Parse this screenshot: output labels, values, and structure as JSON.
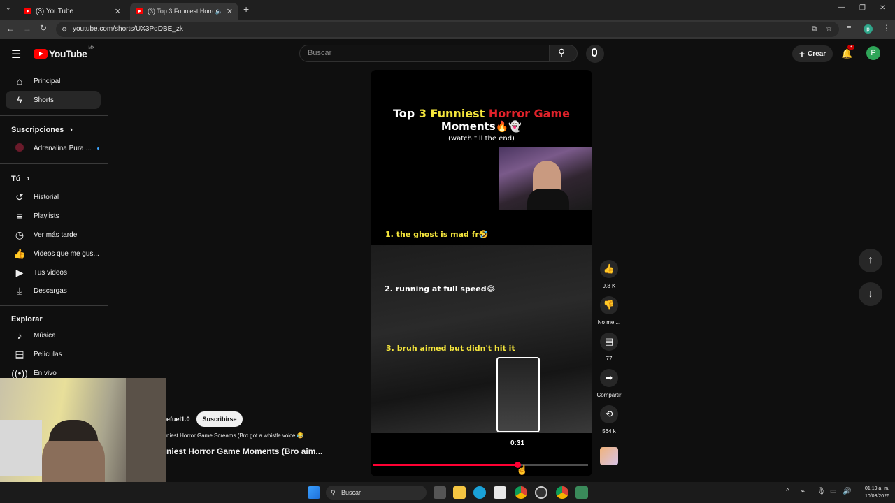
{
  "browser": {
    "tabs": [
      {
        "title": "(3) YouTube"
      },
      {
        "title": "(3) Top 3 Funniest Horror G"
      }
    ],
    "url": "youtube.com/shorts/UX3PqDBE_zk",
    "new_tab": "+"
  },
  "yt": {
    "logo_text": "YouTube",
    "logo_region": "MX",
    "search_placeholder": "Buscar",
    "create_label": "Crear",
    "notif_count": "3",
    "avatar_letter": "P"
  },
  "sidebar": {
    "main": [
      {
        "label": "Principal",
        "icon": "home-icon"
      },
      {
        "label": "Shorts",
        "icon": "shorts-icon"
      }
    ],
    "subs_title": "Suscripciones",
    "subs": [
      {
        "label": "Adrenalina Pura ..."
      }
    ],
    "you_title": "Tú",
    "you": [
      {
        "label": "Historial",
        "icon": "history-icon"
      },
      {
        "label": "Playlists",
        "icon": "playlist-icon"
      },
      {
        "label": "Ver más tarde",
        "icon": "clock-icon"
      },
      {
        "label": "Videos que me gus...",
        "icon": "like-icon"
      },
      {
        "label": "Tus videos",
        "icon": "video-icon"
      },
      {
        "label": "Descargas",
        "icon": "download-icon"
      }
    ],
    "explore_title": "Explorar",
    "explore": [
      {
        "label": "Música",
        "icon": "music-icon"
      },
      {
        "label": "Películas",
        "icon": "film-icon"
      },
      {
        "label": "En vivo",
        "icon": "live-icon"
      }
    ]
  },
  "short": {
    "title_line1_a": "Top ",
    "title_line1_b": "3 Funniest ",
    "title_line1_c": "Horror Game",
    "title_line2": "Moments🔥👻",
    "title_line3": "(watch till the end)",
    "items": [
      {
        "num": "1.",
        "text": "the ghost is mad fr🤣"
      },
      {
        "num": "2.",
        "text": "running at full speed😂"
      },
      {
        "num": "3.",
        "text": "bruh aimed but didn't hit it"
      }
    ],
    "preview_time": "0:31",
    "progress": 0.67,
    "channel": "efuel1.0",
    "subscribe": "Suscribirse",
    "sound": "niest Horror Game Screams (Bro got a whistle voice 😂 ...",
    "caption": "niest Horror Game Moments (Bro aim..."
  },
  "actions": {
    "likes": "9.8 K",
    "dislike": "No me ...",
    "comments": "77",
    "share": "Compartir",
    "remix": "564 k"
  },
  "taskbar": {
    "search": "Buscar",
    "time": "01:19 a. m.",
    "date": "10/03/2026"
  }
}
